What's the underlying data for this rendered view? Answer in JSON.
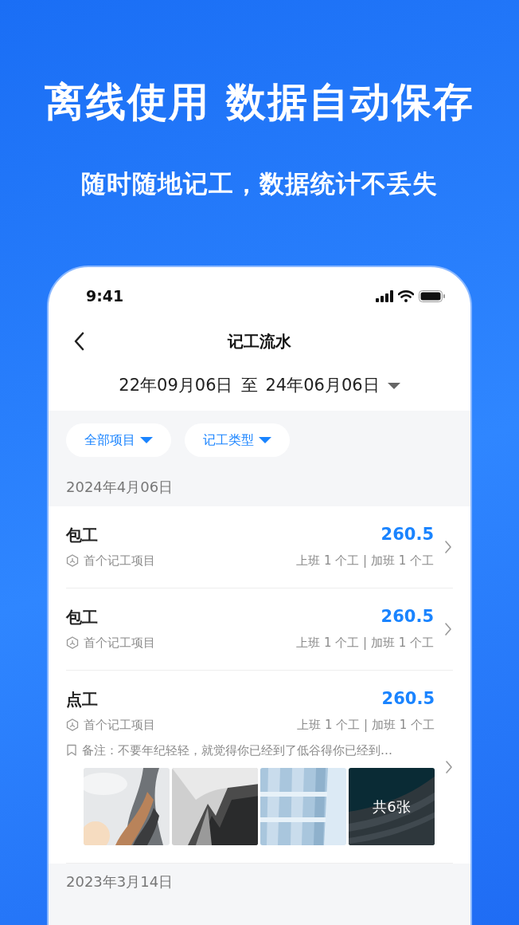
{
  "headline": "离线使用 数据自动保存",
  "subheadline": "随时随地记工，数据统计不丢失",
  "status_bar": {
    "time": "9:41"
  },
  "nav": {
    "title": "记工流水"
  },
  "date_range": {
    "start": "22年09月06日",
    "separator": "至",
    "end": "24年06月06日"
  },
  "filters": [
    {
      "label": "全部项目"
    },
    {
      "label": "记工类型"
    }
  ],
  "groups": [
    {
      "date": "2024年4月06日",
      "records": [
        {
          "type": "包工",
          "amount": "260.5",
          "project": "首个记工项目",
          "summary": "上班 1 个工 | 加班 1 个工"
        },
        {
          "type": "包工",
          "amount": "260.5",
          "project": "首个记工项目",
          "summary": "上班 1 个工 | 加班 1 个工"
        },
        {
          "type": "点工",
          "amount": "260.5",
          "project": "首个记工项目",
          "summary": "上班 1 个工 | 加班 1 个工",
          "note": "备注：不要年纪轻轻，就觉得你已经到了低谷得你已经到…",
          "photo_count": "共6张"
        }
      ]
    },
    {
      "date": "2023年3月14日"
    }
  ]
}
